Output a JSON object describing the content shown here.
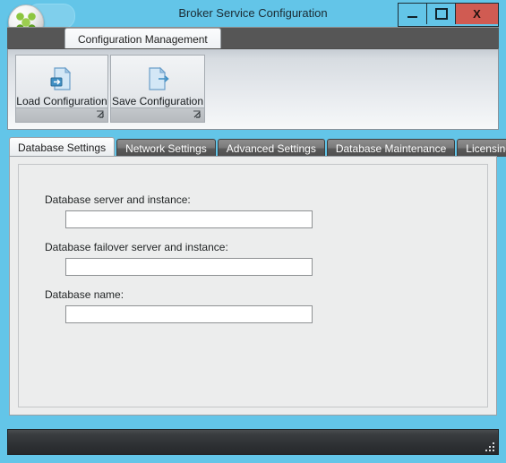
{
  "window": {
    "title": "Broker Service Configuration",
    "app_icon": "citrix-logo-icon",
    "controls": {
      "minimize": "minimize-icon",
      "maximize": "maximize-icon",
      "close": "X"
    },
    "frame_color": "#63c5e8",
    "close_button_color": "#d05b52"
  },
  "ribbon": {
    "tab_label": "Configuration Management",
    "groups": [
      {
        "id": "load",
        "label": "Load Configuration",
        "icon": "document-import-icon",
        "launcher": "dialog-launcher-icon"
      },
      {
        "id": "save",
        "label": "Save Configuration",
        "icon": "document-export-icon",
        "launcher": "dialog-launcher-icon"
      }
    ]
  },
  "tabs": [
    {
      "label": "Database Settings",
      "active": true
    },
    {
      "label": "Network Settings",
      "active": false
    },
    {
      "label": "Advanced Settings",
      "active": false
    },
    {
      "label": "Database Maintenance",
      "active": false
    },
    {
      "label": "Licensing",
      "active": false
    }
  ],
  "database_settings": {
    "fields": [
      {
        "label": "Database server and instance:",
        "value": "",
        "placeholder": ""
      },
      {
        "label": "Database failover server and instance:",
        "value": "",
        "placeholder": ""
      },
      {
        "label": "Database name:",
        "value": "",
        "placeholder": ""
      }
    ]
  },
  "statusbar": {
    "text": "",
    "grip": "resize-grip-icon"
  }
}
